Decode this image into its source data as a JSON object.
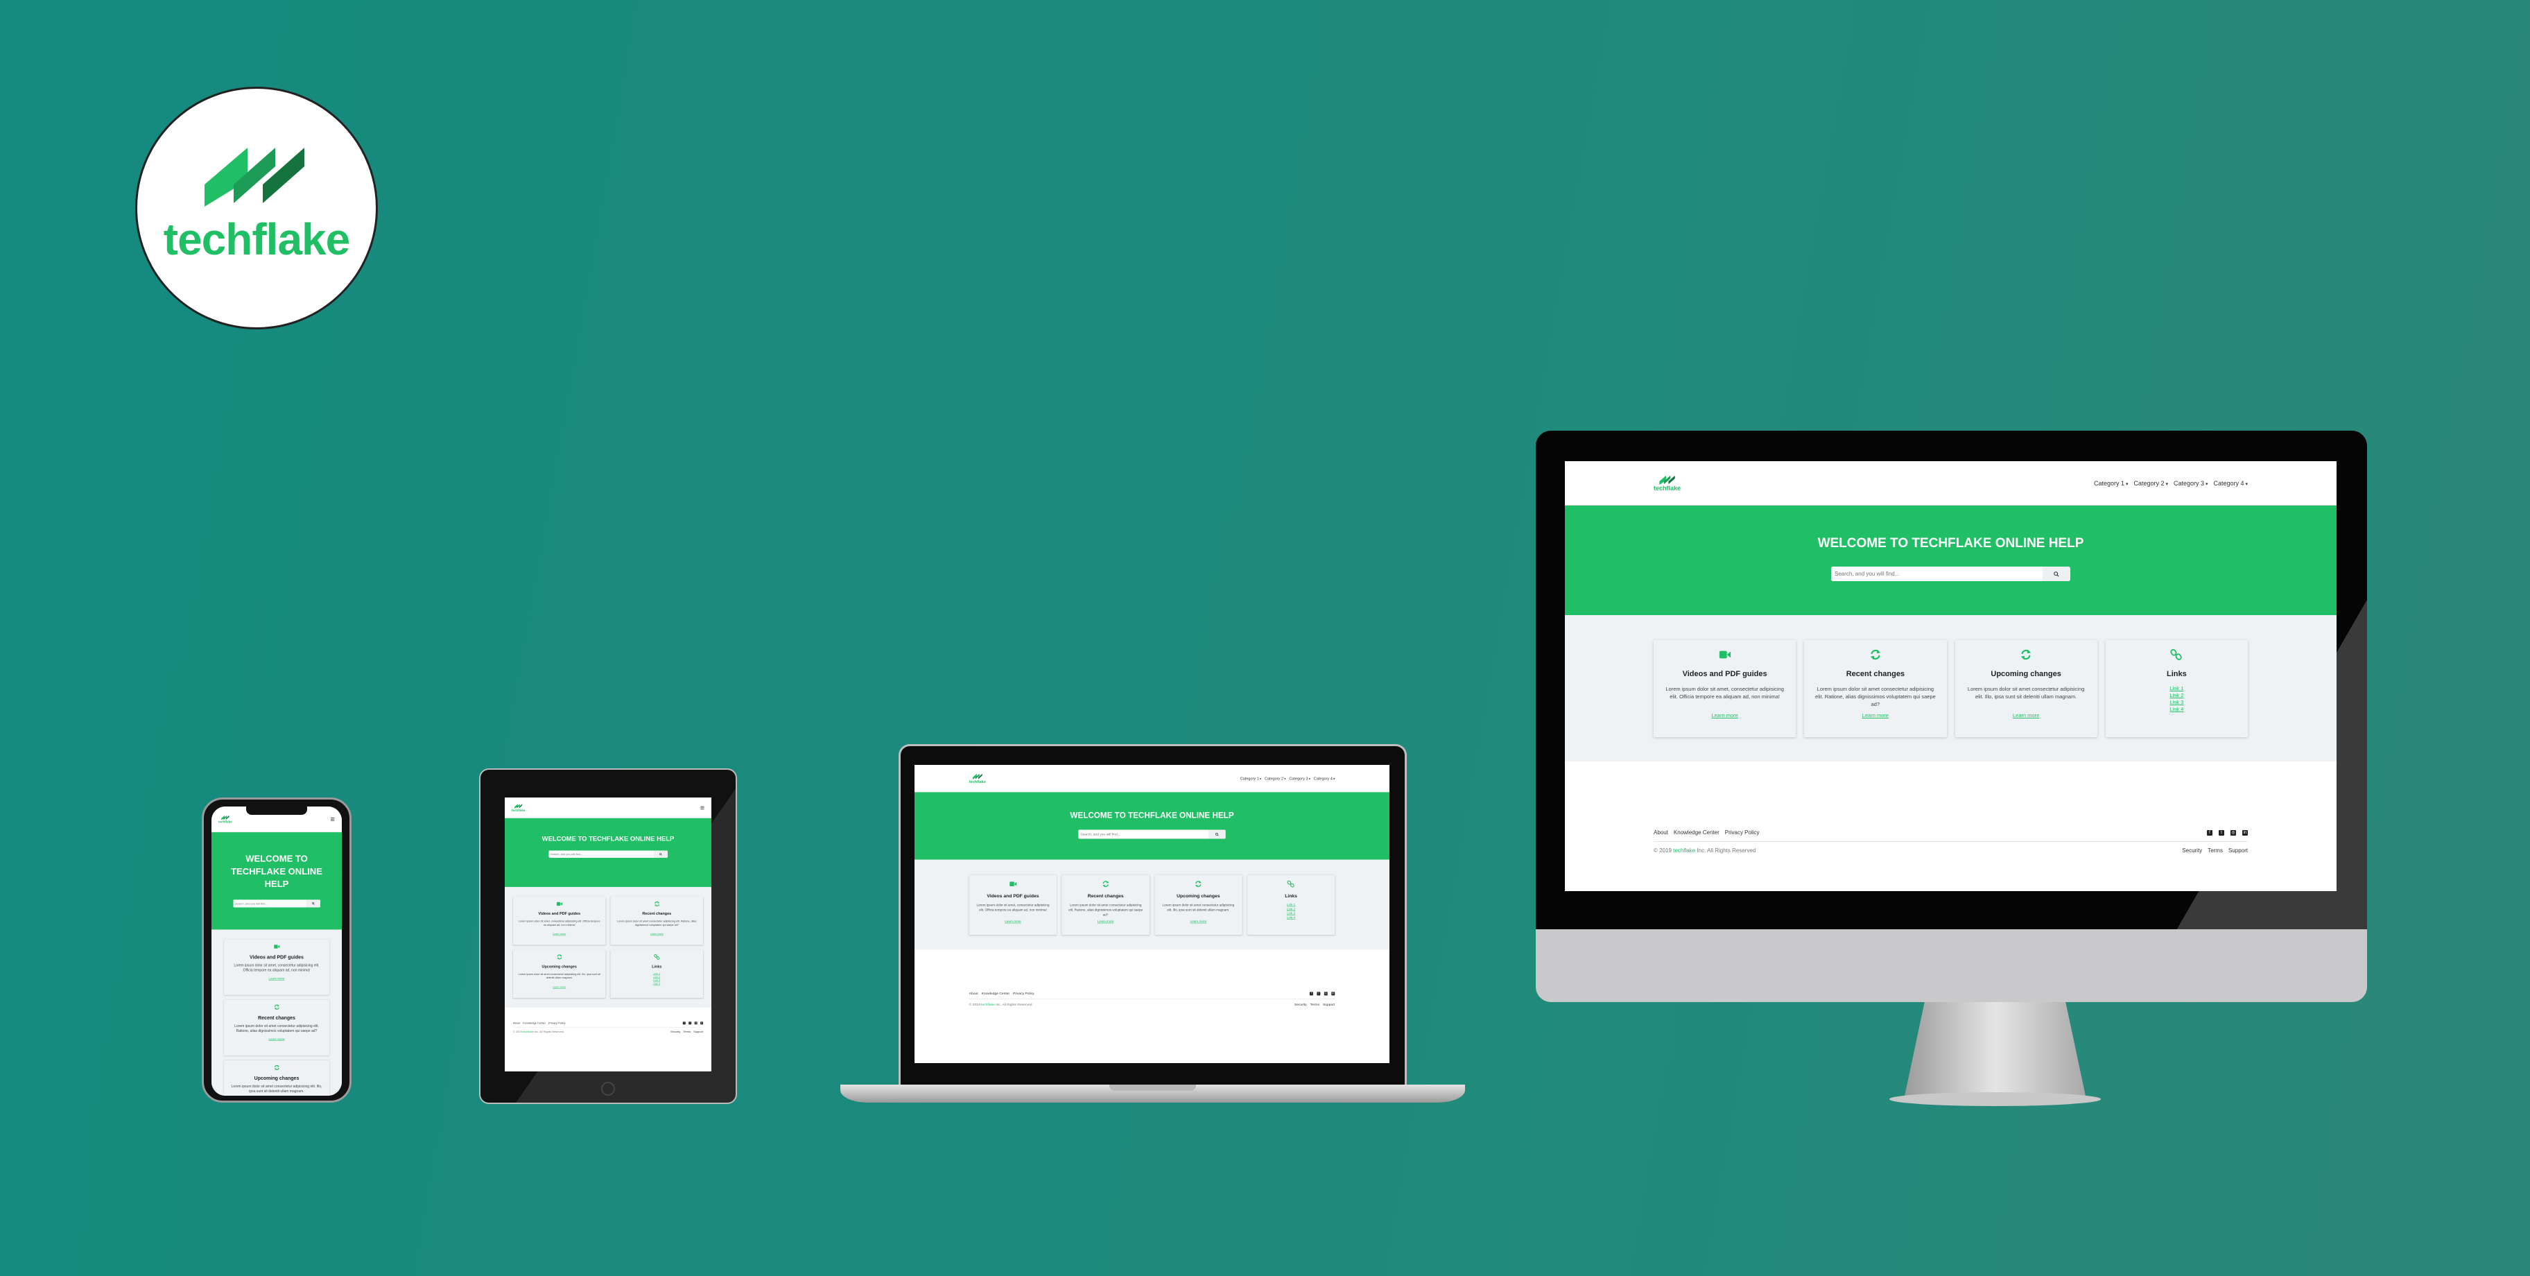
{
  "brand": {
    "name": "techflake",
    "colors": {
      "green": "#21bf65",
      "green_mid": "#1e9b57",
      "green_dark": "#15733e",
      "teal_bg": "#178a7d",
      "card_bg": "#eff2f5"
    }
  },
  "header": {
    "nav": [
      "Category 1",
      "Category 2",
      "Category 3",
      "Category 4"
    ],
    "menu_icon": "hamburger-icon"
  },
  "hero": {
    "title": "WELCOME TO TECHFLAKE ONLINE HELP",
    "search_placeholder": "Search, and you will find...",
    "search_icon": "search-icon"
  },
  "cards": [
    {
      "icon": "video-camera-icon",
      "title": "Videos and PDF guides",
      "text": "Lorem ipsum dolor sit amet, consectetur adipisicing elit. Officia tempore ea aliquam ad, non minima!",
      "link": "Learn more"
    },
    {
      "icon": "sync-icon",
      "title": "Recent changes",
      "text": "Lorem ipsum dolor sit amet consectetur adipisicing elit. Ratione, alias dignissimos voluptatem qui saepe ad?",
      "link": "Learn more"
    },
    {
      "icon": "sync-icon",
      "title": "Upcoming changes",
      "text": "Lorem ipsum dolor sit amet consectetur adipisicing elit. Illo, ipsa sunt sit deleniti ullam magnam.",
      "link": "Learn more"
    },
    {
      "icon": "link-icon",
      "title": "Links",
      "links": [
        "Link 1",
        "Link 2",
        "Link 3",
        "Link 4"
      ]
    }
  ],
  "footer": {
    "links": [
      "About",
      "Knowledge Center",
      "Privacy Policy"
    ],
    "copyright_prefix": "© 2019",
    "copyright_brand": "techflake",
    "copyright_suffix": "Inc. All Rights Reserved",
    "social": [
      "facebook-icon",
      "twitter-icon",
      "instagram-icon",
      "linkedin-icon"
    ],
    "right_links": [
      "Security",
      "Terms",
      "Support"
    ]
  }
}
